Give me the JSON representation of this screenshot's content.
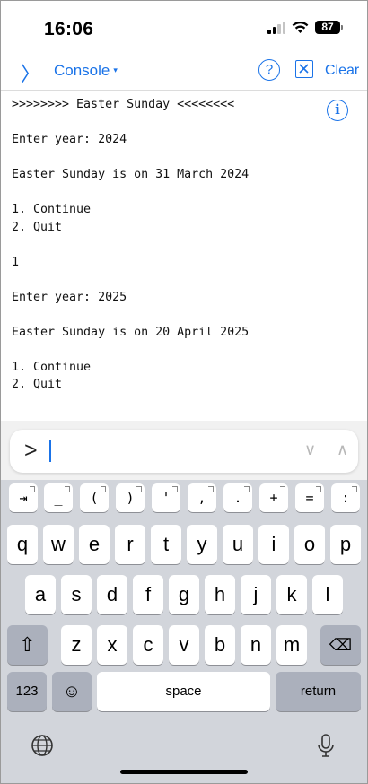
{
  "status_bar": {
    "time": "16:06",
    "battery": "87",
    "signal_icon": "cellular-signal-icon",
    "wifi_icon": "wifi-icon"
  },
  "nav": {
    "back_icon": "〉",
    "title": "Console",
    "caret": "▾",
    "help_icon": "?",
    "clear_label": "Clear",
    "accent_color": "#1a73e8"
  },
  "console": {
    "lines": [
      ">>>>>>>> Easter Sunday <<<<<<<<",
      "",
      "Enter year: 2024",
      "",
      "Easter Sunday is on 31 March 2024",
      "",
      "1. Continue",
      "2. Quit",
      "",
      "1",
      "",
      "Enter year: 2025",
      "",
      "Easter Sunday is on 20 April 2025",
      "",
      "1. Continue",
      "2. Quit"
    ],
    "info_icon": "i"
  },
  "input": {
    "prompt": ">",
    "value": "",
    "history_down": "∨",
    "history_up": "∧"
  },
  "keyboard": {
    "toolbar_keys": [
      "⇥",
      "_",
      "(",
      ")",
      "'",
      ",",
      ".",
      "+",
      "=",
      ":"
    ],
    "row1": [
      "q",
      "w",
      "e",
      "r",
      "t",
      "y",
      "u",
      "i",
      "o",
      "p"
    ],
    "row2": [
      "a",
      "s",
      "d",
      "f",
      "g",
      "h",
      "j",
      "k",
      "l"
    ],
    "row3": [
      "z",
      "x",
      "c",
      "v",
      "b",
      "n",
      "m"
    ],
    "shift": "⇧",
    "delete": "⌫",
    "numbers_label": "123",
    "emoji": "☺",
    "space_label": "space",
    "return_label": "return",
    "globe": "🌐",
    "mic": "🎙"
  }
}
